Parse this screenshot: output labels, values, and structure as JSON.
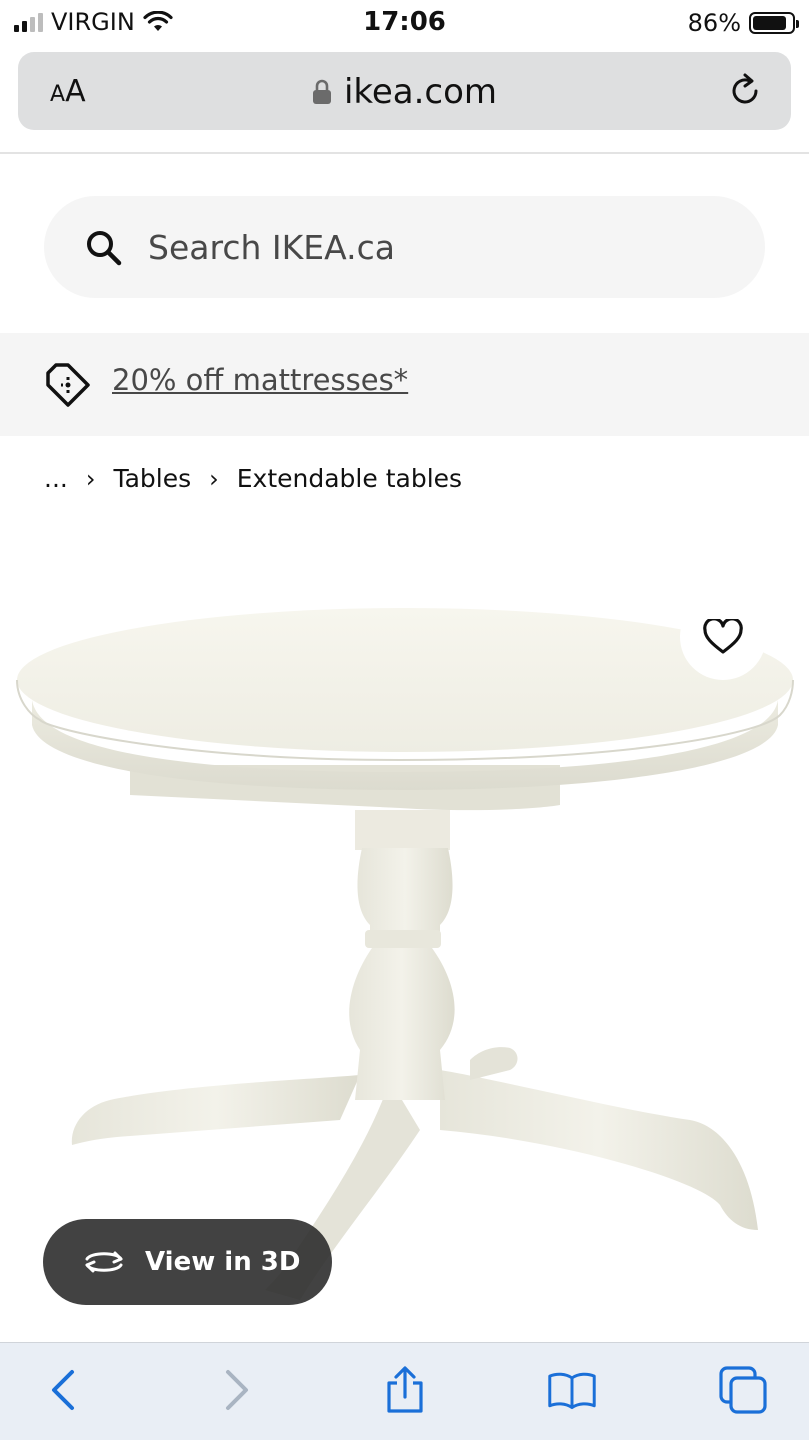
{
  "status": {
    "carrier": "VIRGIN",
    "time": "17:06",
    "battery": "86%",
    "battery_level": 0.86
  },
  "browser": {
    "text_size_label_small": "A",
    "text_size_label_large": "A",
    "domain": "ikea.com"
  },
  "search": {
    "placeholder": "Search IKEA.ca"
  },
  "promo": {
    "label": "20% off mattresses*"
  },
  "breadcrumb": {
    "ellipsis": "...",
    "items": [
      "Tables",
      "Extendable tables"
    ]
  },
  "product": {
    "view3d_label": "View in 3D"
  },
  "icons": {
    "search": "search-icon",
    "lock": "lock-icon",
    "reload": "reload-icon",
    "tag": "price-tag-icon",
    "favorite": "heart-icon",
    "rotate": "rotate-3d-icon",
    "back": "back-arrow-icon",
    "forward": "forward-arrow-icon",
    "share": "share-icon",
    "bookmarks": "bookmarks-icon",
    "tabs": "tabs-icon"
  },
  "colors": {
    "accent_blue": "#1a6fd8",
    "dark_pill": "#282828",
    "light_gray": "#f5f5f5"
  }
}
